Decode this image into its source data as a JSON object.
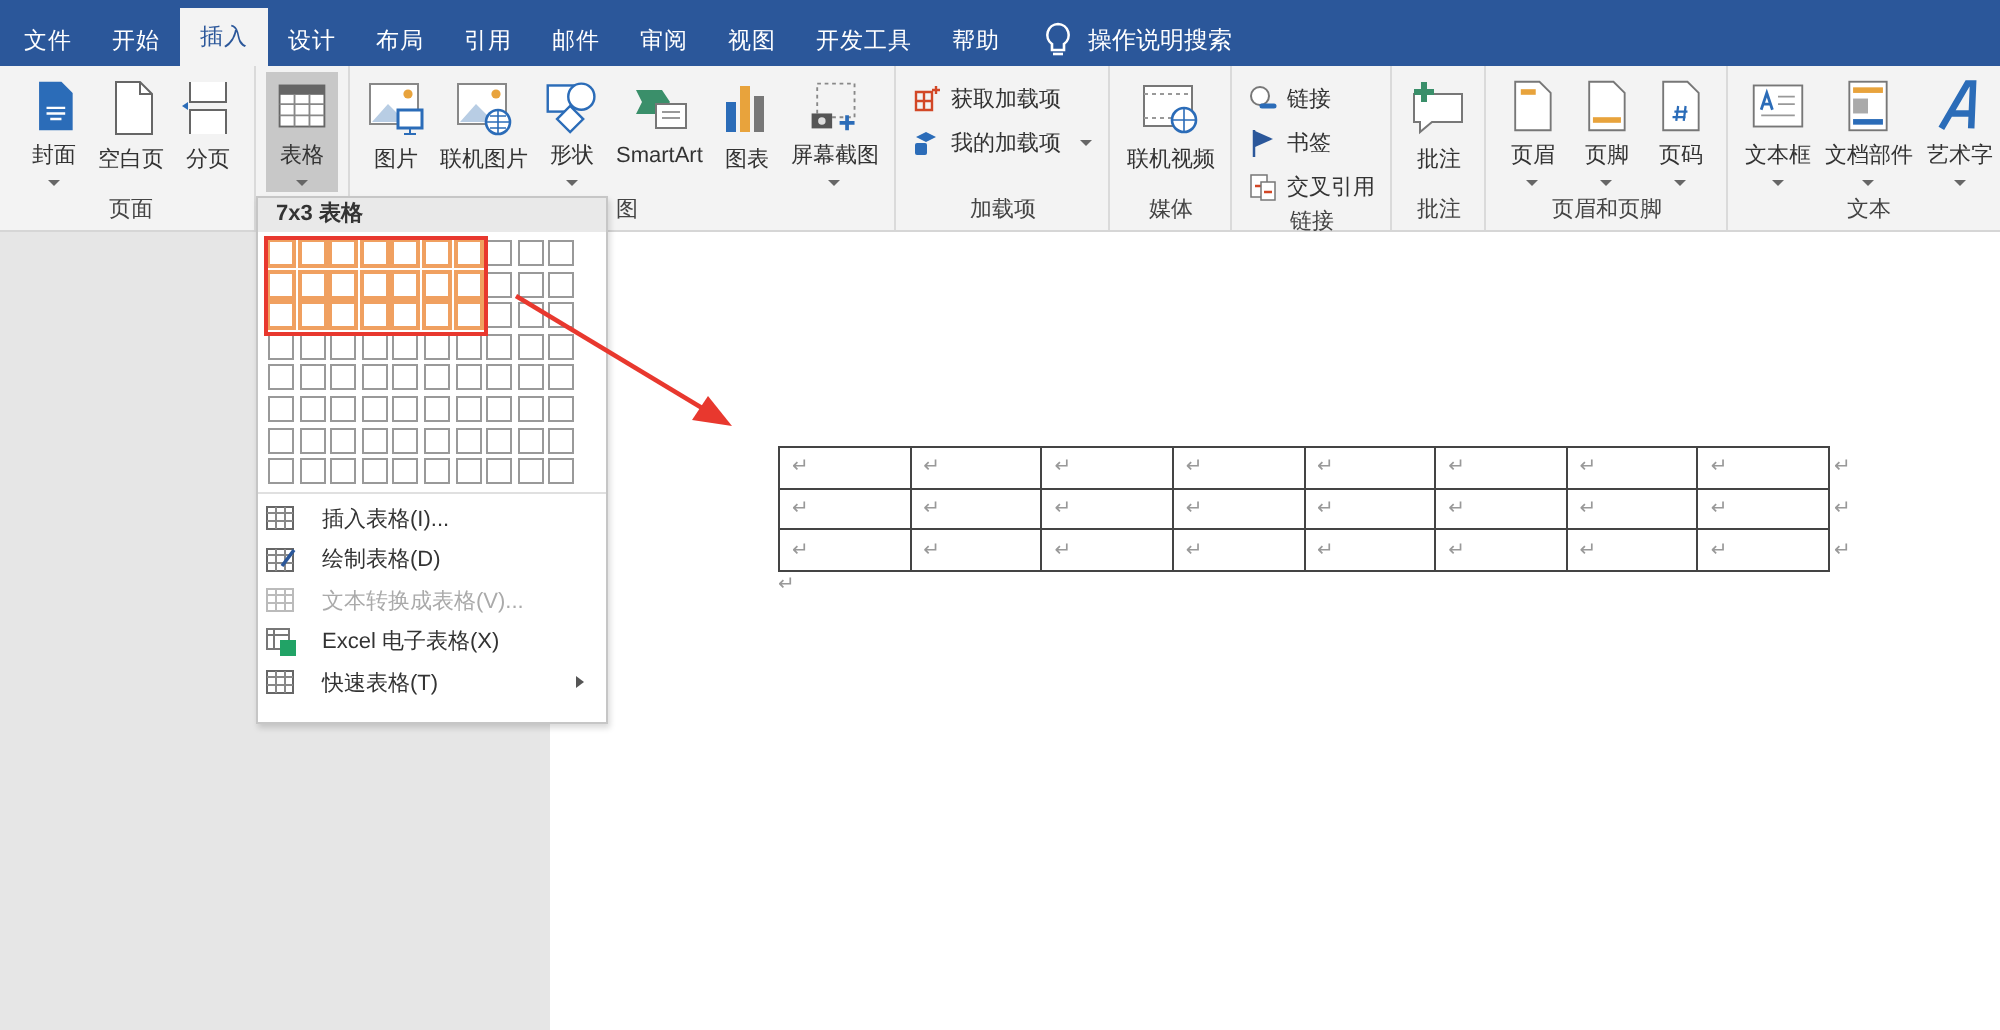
{
  "tabs": [
    {
      "label": "文件",
      "selected": false
    },
    {
      "label": "开始",
      "selected": false
    },
    {
      "label": "插入",
      "selected": true
    },
    {
      "label": "设计",
      "selected": false
    },
    {
      "label": "布局",
      "selected": false
    },
    {
      "label": "引用",
      "selected": false
    },
    {
      "label": "邮件",
      "selected": false
    },
    {
      "label": "审阅",
      "selected": false
    },
    {
      "label": "视图",
      "selected": false
    },
    {
      "label": "开发工具",
      "selected": false
    },
    {
      "label": "帮助",
      "selected": false
    }
  ],
  "search": {
    "text": "操作说明搜索"
  },
  "ribbon": {
    "groups": [
      {
        "label": "页面",
        "items": [
          {
            "kind": "large",
            "label": "封面",
            "dropdown": true,
            "selected": false
          },
          {
            "kind": "large",
            "label": "空白页",
            "dropdown": false,
            "selected": false
          },
          {
            "kind": "large",
            "label": "分页",
            "dropdown": false,
            "selected": false
          }
        ]
      },
      {
        "items": [
          {
            "kind": "large",
            "label": "表格",
            "dropdown": true,
            "selected": true
          }
        ]
      },
      {
        "label": "图",
        "items": [
          {
            "kind": "large",
            "label": "图片",
            "dropdown": false,
            "selected": false
          },
          {
            "kind": "large",
            "label": "联机图片",
            "dropdown": false,
            "selected": false
          },
          {
            "kind": "large",
            "label": "形状",
            "dropdown": true,
            "selected": false
          },
          {
            "kind": "large",
            "label": "SmartArt",
            "dropdown": false,
            "selected": false
          },
          {
            "kind": "large",
            "label": "图表",
            "dropdown": false,
            "selected": false
          },
          {
            "kind": "large",
            "label": "屏幕截图",
            "dropdown": true,
            "selected": false
          }
        ]
      },
      {
        "label": "加载项",
        "items": [
          {
            "kind": "small",
            "label": "获取加载项",
            "dropdown": false,
            "selected": false
          },
          {
            "kind": "small",
            "label": "我的加载项",
            "dropdown": true,
            "selected": false
          }
        ]
      },
      {
        "label": "媒体",
        "items": [
          {
            "kind": "large",
            "label": "联机视频",
            "dropdown": false,
            "selected": false
          }
        ]
      },
      {
        "label": "链接",
        "items": [
          {
            "kind": "small",
            "label": "链接",
            "dropdown": false,
            "selected": false
          },
          {
            "kind": "small",
            "label": "书签",
            "dropdown": false,
            "selected": false
          },
          {
            "kind": "small",
            "label": "交叉引用",
            "dropdown": false,
            "selected": false
          }
        ]
      },
      {
        "label": "批注",
        "items": [
          {
            "kind": "large",
            "label": "批注",
            "dropdown": false,
            "selected": false
          }
        ]
      },
      {
        "label": "页眉和页脚",
        "items": [
          {
            "kind": "large",
            "label": "页眉",
            "dropdown": true,
            "selected": false
          },
          {
            "kind": "large",
            "label": "页脚",
            "dropdown": true,
            "selected": false
          },
          {
            "kind": "large",
            "label": "页码",
            "dropdown": true,
            "selected": false
          }
        ]
      },
      {
        "label": "文本",
        "items": [
          {
            "kind": "large",
            "label": "文本框",
            "dropdown": true,
            "selected": false
          },
          {
            "kind": "large",
            "label": "文档部件",
            "dropdown": true,
            "selected": false
          },
          {
            "kind": "large",
            "label": "艺术字",
            "dropdown": true,
            "selected": false
          }
        ]
      }
    ]
  },
  "table_menu": {
    "header": "7x3 表格",
    "grid": [
      [
        {
          "selected": true
        },
        {
          "selected": true
        },
        {
          "selected": true
        },
        {
          "selected": true
        },
        {
          "selected": true
        },
        {
          "selected": true
        },
        {
          "selected": true
        },
        {
          "selected": false
        },
        {
          "selected": false
        },
        {
          "selected": false
        }
      ],
      [
        {
          "selected": true
        },
        {
          "selected": true
        },
        {
          "selected": true
        },
        {
          "selected": true
        },
        {
          "selected": true
        },
        {
          "selected": true
        },
        {
          "selected": true
        },
        {
          "selected": false
        },
        {
          "selected": false
        },
        {
          "selected": false
        }
      ],
      [
        {
          "selected": true
        },
        {
          "selected": true
        },
        {
          "selected": true
        },
        {
          "selected": true
        },
        {
          "selected": true
        },
        {
          "selected": true
        },
        {
          "selected": true
        },
        {
          "selected": false
        },
        {
          "selected": false
        },
        {
          "selected": false
        }
      ],
      [
        {
          "selected": false
        },
        {
          "selected": false
        },
        {
          "selected": false
        },
        {
          "selected": false
        },
        {
          "selected": false
        },
        {
          "selected": false
        },
        {
          "selected": false
        },
        {
          "selected": false
        },
        {
          "selected": false
        },
        {
          "selected": false
        }
      ],
      [
        {
          "selected": false
        },
        {
          "selected": false
        },
        {
          "selected": false
        },
        {
          "selected": false
        },
        {
          "selected": false
        },
        {
          "selected": false
        },
        {
          "selected": false
        },
        {
          "selected": false
        },
        {
          "selected": false
        },
        {
          "selected": false
        }
      ],
      [
        {
          "selected": false
        },
        {
          "selected": false
        },
        {
          "selected": false
        },
        {
          "selected": false
        },
        {
          "selected": false
        },
        {
          "selected": false
        },
        {
          "selected": false
        },
        {
          "selected": false
        },
        {
          "selected": false
        },
        {
          "selected": false
        }
      ],
      [
        {
          "selected": false
        },
        {
          "selected": false
        },
        {
          "selected": false
        },
        {
          "selected": false
        },
        {
          "selected": false
        },
        {
          "selected": false
        },
        {
          "selected": false
        },
        {
          "selected": false
        },
        {
          "selected": false
        },
        {
          "selected": false
        }
      ],
      [
        {
          "selected": false
        },
        {
          "selected": false
        },
        {
          "selected": false
        },
        {
          "selected": false
        },
        {
          "selected": false
        },
        {
          "selected": false
        },
        {
          "selected": false
        },
        {
          "selected": false
        },
        {
          "selected": false
        },
        {
          "selected": false
        }
      ]
    ],
    "items": [
      {
        "label": "插入表格(I)...",
        "disabled": false,
        "submenu": false
      },
      {
        "label": "绘制表格(D)",
        "disabled": false,
        "submenu": false
      },
      {
        "label": "文本转换成表格(V)...",
        "disabled": true,
        "submenu": false
      },
      {
        "label": "Excel 电子表格(X)",
        "disabled": false,
        "submenu": false
      },
      {
        "label": "快速表格(T)",
        "disabled": false,
        "submenu": true
      }
    ]
  },
  "document": {
    "table": {
      "rows": [
        {
          "cells": [
            "↵",
            "↵",
            "↵",
            "↵",
            "↵",
            "↵",
            "↵",
            "↵"
          ],
          "end_mark": "↵"
        },
        {
          "cells": [
            "↵",
            "↵",
            "↵",
            "↵",
            "↵",
            "↵",
            "↵",
            "↵"
          ],
          "end_mark": "↵"
        },
        {
          "cells": [
            "↵",
            "↵",
            "↵",
            "↵",
            "↵",
            "↵",
            "↵",
            "↵"
          ],
          "end_mark": "↵"
        }
      ]
    },
    "paragraph_mark": "↵"
  }
}
